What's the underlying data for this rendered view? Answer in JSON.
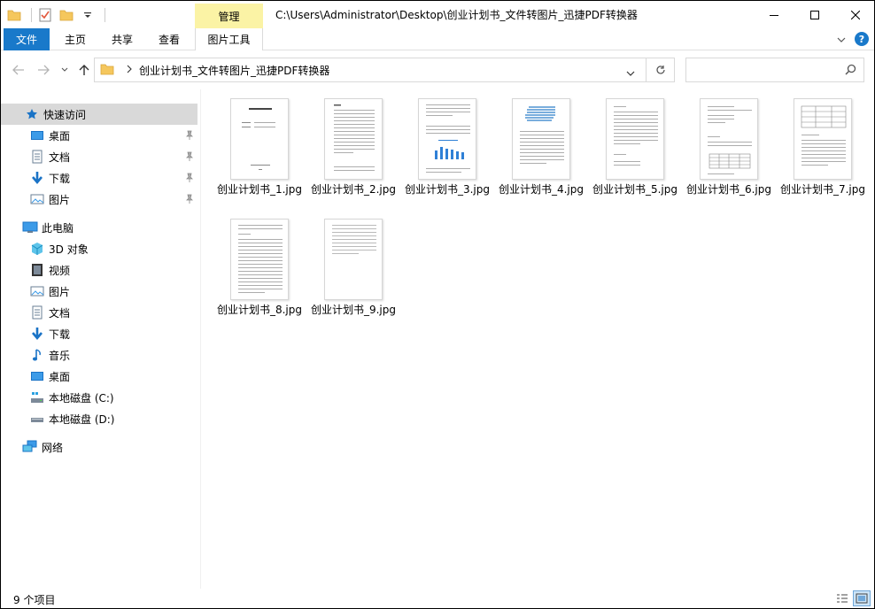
{
  "titlebar": {
    "context_tab": "管理",
    "title": "C:\\Users\\Administrator\\Desktop\\创业计划书_文件转图片_迅捷PDF转换器"
  },
  "ribbon": {
    "tabs": [
      "文件",
      "主页",
      "共享",
      "查看",
      "图片工具"
    ]
  },
  "address": {
    "path": "创业计划书_文件转图片_迅捷PDF转换器",
    "search_placeholder": ""
  },
  "nav": {
    "quick_access": "快速访问",
    "quick_items": [
      "桌面",
      "文档",
      "下载",
      "图片"
    ],
    "this_pc": "此电脑",
    "pc_items": [
      "3D 对象",
      "视频",
      "图片",
      "文档",
      "下载",
      "音乐",
      "桌面",
      "本地磁盘 (C:)",
      "本地磁盘 (D:)"
    ],
    "network": "网络"
  },
  "files": [
    {
      "name": "创业计划书_1.jpg"
    },
    {
      "name": "创业计划书_2.jpg"
    },
    {
      "name": "创业计划书_3.jpg"
    },
    {
      "name": "创业计划书_4.jpg"
    },
    {
      "name": "创业计划书_5.jpg"
    },
    {
      "name": "创业计划书_6.jpg"
    },
    {
      "name": "创业计划书_7.jpg"
    },
    {
      "name": "创业计划书_8.jpg"
    },
    {
      "name": "创业计划书_9.jpg"
    }
  ],
  "status": {
    "item_count": "9 个项目"
  },
  "colors": {
    "accent": "#1979ca",
    "context_tab": "#fbf3a5",
    "selected": "#d9d9d9"
  }
}
